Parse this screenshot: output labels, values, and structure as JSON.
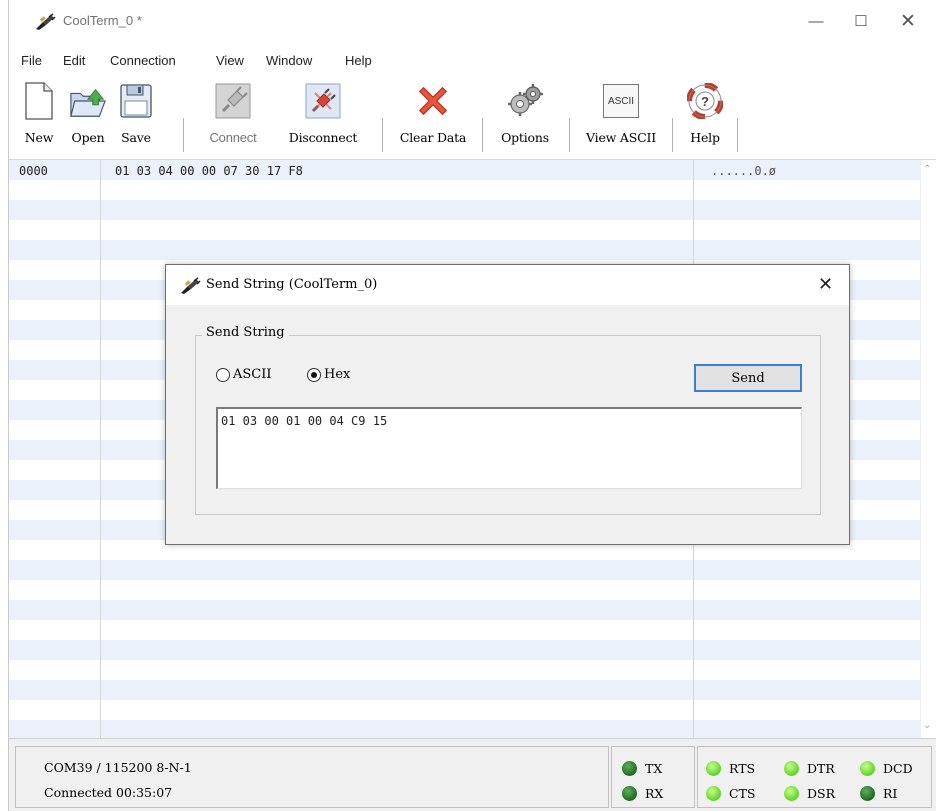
{
  "window": {
    "title": "CoolTerm_0 *",
    "controls": {
      "minimize": "—",
      "maximize": "☐",
      "close": "✕"
    }
  },
  "menu": [
    "File",
    "Edit",
    "Connection",
    "View",
    "Window",
    "Help"
  ],
  "toolbar": {
    "new": "New",
    "open": "Open",
    "save": "Save",
    "connect": "Connect",
    "disconnect": "Disconnect",
    "clear_data": "Clear Data",
    "options": "Options",
    "view_ascii": "View ASCII",
    "view_ascii_icon_text": "ASCII",
    "help": "Help"
  },
  "data_view": {
    "rows": [
      {
        "offset": "0000",
        "hex": "01 03 04 00 00 07 30 17 F8",
        "ascii": "......0.ø"
      }
    ]
  },
  "status": {
    "port": "COM39 / 115200 8-N-1",
    "connection": "Connected 00:35:07",
    "leds": {
      "tx": "TX",
      "rx": "RX",
      "rts": "RTS",
      "cts": "CTS",
      "dtr": "DTR",
      "dsr": "DSR",
      "dcd": "DCD",
      "ri": "RI"
    }
  },
  "dialog": {
    "title": "Send String (CoolTerm_0)",
    "close": "✕",
    "group_label": "Send String",
    "radio_ascii": "ASCII",
    "radio_hex": "Hex",
    "selected_mode": "Hex",
    "send_button": "Send",
    "input_value": "01 03 00 01 00 04 C9 15"
  },
  "colors": {
    "stripe": "#eaf1fb",
    "led_on": "#1f6a1f",
    "led_bright": "#5fd22a",
    "send_button_border": "#3c7fd0"
  }
}
